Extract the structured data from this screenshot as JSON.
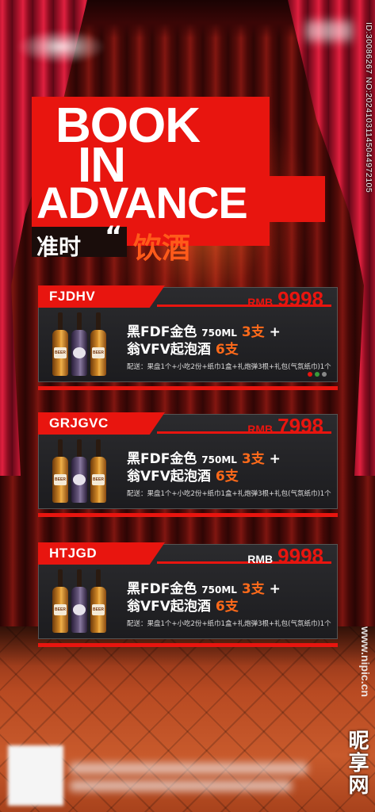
{
  "title": {
    "line1": "BOOK",
    "line2": "IN",
    "line3": "ADVANCE",
    "subtitle_a": "准时",
    "quote": "“",
    "subtitle_b": "饮酒"
  },
  "colors": {
    "accent": "#e8150f",
    "highlight": "#ff6a1a",
    "panel": "#1f1f22",
    "curtain": "#b3142e"
  },
  "cards": [
    {
      "name": "FJDHV",
      "currency": "RMB",
      "price": "9998",
      "price_color": "red",
      "item1_name": "黑FDF金色",
      "item1_size": "750ML",
      "item1_qty": "3支",
      "item1_plus": "+",
      "item2_name": "翁VFV起泡酒",
      "item2_qty": "6支",
      "detail": "配送：果盘1个+小吃2份+纸巾1盒+礼炮弹3根+礼包(气氛纸巾)1个",
      "bottle_label": "BEER"
    },
    {
      "name": "GRJGVC",
      "currency": "RMB",
      "price": "7998",
      "price_color": "red",
      "item1_name": "黑FDF金色",
      "item1_size": "750ML",
      "item1_qty": "3支",
      "item1_plus": "+",
      "item2_name": "翁VFV起泡酒",
      "item2_qty": "6支",
      "detail": "配送：果盘1个+小吃2份+纸巾1盒+礼炮弹3根+礼包(气氛纸巾)1个",
      "bottle_label": "BEER"
    },
    {
      "name": "HTJGD",
      "currency": "RMB",
      "price": "9998",
      "price_color": "white-currency",
      "item1_name": "黑FDF金色",
      "item1_size": "750ML",
      "item1_qty": "3支",
      "item1_plus": "+",
      "item2_name": "翁VFV起泡酒",
      "item2_qty": "6支",
      "detail": "配送：果盘1个+小吃2份+纸巾1盒+礼炮弹3根+礼包(气氛纸巾)1个",
      "bottle_label": "BEER"
    }
  ],
  "watermark": {
    "id_text": "ID:30086267 NO:20241031145044972105",
    "site": "www.nipic.cn",
    "logo": "昵享网"
  }
}
